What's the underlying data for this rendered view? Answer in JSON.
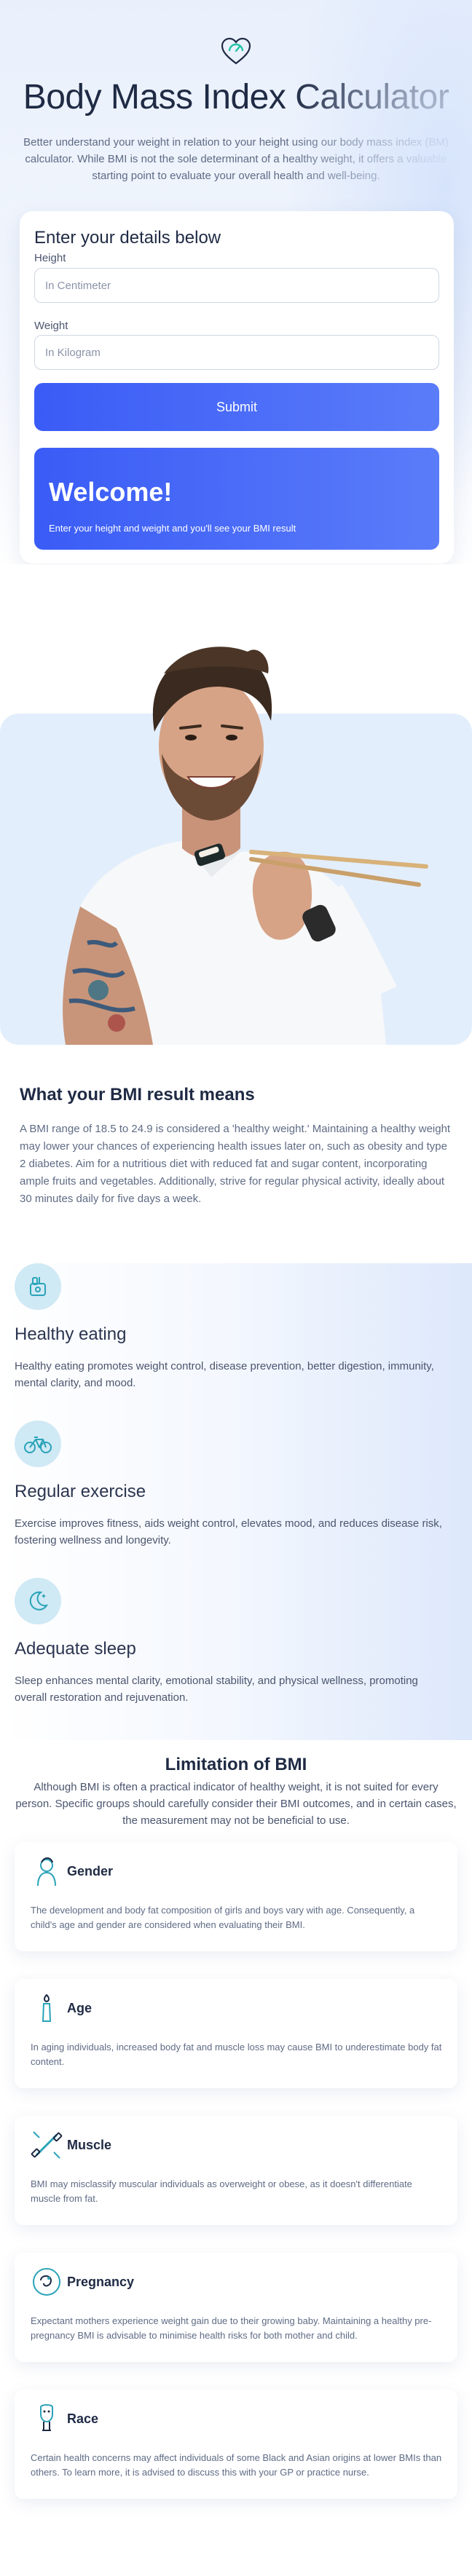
{
  "hero": {
    "logo": "heart-scale-icon",
    "title": "Body Mass Index Calculator",
    "description": "Better understand your weight in relation to your height using our body mass index (BM) calculator. While BMI is not the sole determinant of a healthy weight, it offers a valuable starting point to evaluate your overall health and well-being."
  },
  "form": {
    "title": "Enter your details below",
    "height_label": "Height",
    "height_placeholder": "In Centimeter",
    "weight_label": "Weight",
    "weight_placeholder": "In Kilogram",
    "submit_label": "Submit",
    "welcome_title": "Welcome!",
    "welcome_text": "Enter your height and weight and you'll see your BMI result"
  },
  "photo": {
    "subject": "man-with-chopsticks"
  },
  "meaning": {
    "title": "What your BMI result means",
    "text": "A BMI range of 18.5 to 24.9 is considered a 'healthy weight.' Maintaining a healthy weight may lower your chances of experiencing health issues later on, such as obesity and type 2 diabetes. Aim for a nutritious diet with reduced fat and sugar content, incorporating ample fruits and vegetables. Additionally, strive for regular physical activity, ideally about 30 minutes daily for five days a week."
  },
  "benefits": [
    {
      "icon": "food-icon",
      "title": "Healthy eating",
      "text": "Healthy eating promotes weight control, disease prevention, better digestion, immunity, mental clarity, and mood."
    },
    {
      "icon": "bicycle-icon",
      "title": "Regular exercise",
      "text": "Exercise improves fitness, aids weight control, elevates mood, and reduces disease risk, fostering wellness and longevity."
    },
    {
      "icon": "moon-icon",
      "title": "Adequate sleep",
      "text": "Sleep enhances mental clarity, emotional stability, and physical wellness, promoting overall restoration and rejuvenation."
    }
  ],
  "limitations": {
    "title": "Limitation of BMI",
    "intro": "Although BMI is often a practical indicator of healthy weight, it is not suited for every person. Specific groups should carefully consider their BMI outcomes, and in certain cases, the measurement may not be beneficial to use.",
    "items": [
      {
        "icon": "gender-icon",
        "name": "Gender",
        "text": "The development and body fat composition of girls and boys vary with age. Consequently, a child's age and gender are considered when evaluating their BMI."
      },
      {
        "icon": "age-icon",
        "name": "Age",
        "text": "In aging individuals, increased body fat and muscle loss may cause BMI to underestimate body fat content."
      },
      {
        "icon": "muscle-icon",
        "name": "Muscle",
        "text": "BMI may misclassify muscular individuals as overweight or obese, as it doesn't differentiate muscle from fat."
      },
      {
        "icon": "pregnancy-icon",
        "name": "Pregnancy",
        "text": "Expectant mothers experience weight gain due to their growing baby. Maintaining a healthy pre-pregnancy BMI is advisable to minimise health risks for both mother and child."
      },
      {
        "icon": "race-icon",
        "name": "Race",
        "text": "Certain health concerns may affect individuals of some Black and Asian origins at lower BMIs than others. To learn more, it is advised to discuss this with your GP or practice nurse."
      }
    ]
  },
  "colors": {
    "accent": "#3a5cf6",
    "heading": "#1f2a44",
    "body_text": "#5f6b85",
    "icon_bg": "#cfe9f5",
    "icon_stroke": "#2aa3b8"
  }
}
